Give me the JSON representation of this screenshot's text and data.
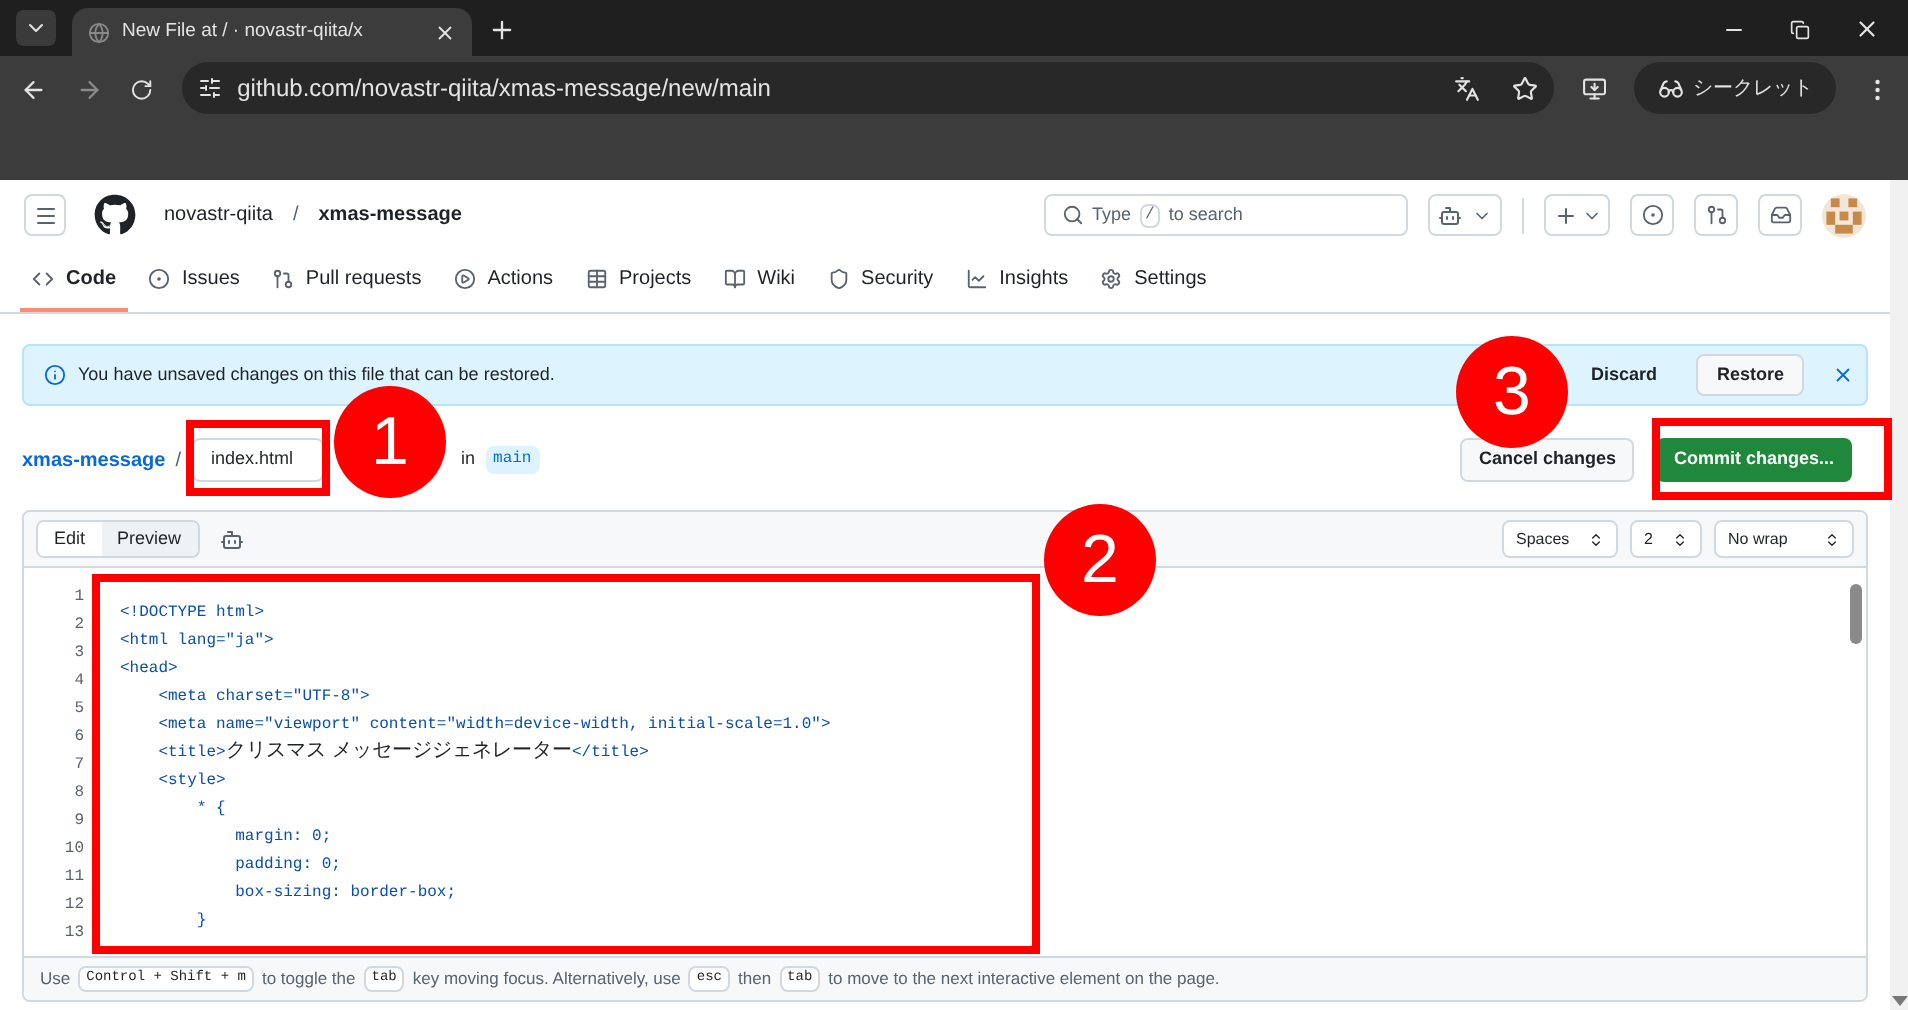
{
  "browser": {
    "tab_title": "New File at / · novastr-qiita/x",
    "url": "github.com/novastr-qiita/xmas-message/new/main",
    "incognito_label": "シークレット"
  },
  "repo": {
    "owner": "novastr-qiita",
    "separator": "/",
    "name": "xmas-message"
  },
  "search": {
    "prefix": "Type",
    "key": "/",
    "suffix": "to search"
  },
  "nav_tabs": [
    {
      "label": "Code",
      "selected": true
    },
    {
      "label": "Issues",
      "selected": false
    },
    {
      "label": "Pull requests",
      "selected": false
    },
    {
      "label": "Actions",
      "selected": false
    },
    {
      "label": "Projects",
      "selected": false
    },
    {
      "label": "Wiki",
      "selected": false
    },
    {
      "label": "Security",
      "selected": false
    },
    {
      "label": "Insights",
      "selected": false
    },
    {
      "label": "Settings",
      "selected": false
    }
  ],
  "banner": {
    "message": "You have unsaved changes on this file that can be restored.",
    "discard": "Discard",
    "restore": "Restore"
  },
  "file": {
    "repo_link": "xmas-message",
    "separator": "/",
    "filename": "index.html",
    "in_label": "in",
    "branch": "main",
    "cancel": "Cancel changes",
    "commit": "Commit changes..."
  },
  "editor": {
    "tabs": [
      {
        "label": "Edit",
        "selected": true
      },
      {
        "label": "Preview",
        "selected": false
      }
    ],
    "indent_mode": "Spaces",
    "indent_size": "2",
    "wrap": "No wrap",
    "lines": [
      {
        "number": "1",
        "segments": [
          {
            "kind": "code",
            "text": "<!DOCTYPE html>"
          }
        ]
      },
      {
        "number": "2",
        "segments": [
          {
            "kind": "code",
            "text": "<html lang=\"ja\">"
          }
        ]
      },
      {
        "number": "3",
        "segments": [
          {
            "kind": "code",
            "text": "<head>"
          }
        ]
      },
      {
        "number": "4",
        "segments": [
          {
            "kind": "code",
            "text": "    <meta charset=\"UTF-8\">"
          }
        ]
      },
      {
        "number": "5",
        "segments": [
          {
            "kind": "code",
            "text": "    <meta name=\"viewport\" content=\"width=device-width, initial-scale=1.0\">"
          }
        ]
      },
      {
        "number": "6",
        "segments": [
          {
            "kind": "code",
            "text": "    <title>"
          },
          {
            "kind": "plain",
            "text": "クリスマス メッセージジェネレーター"
          },
          {
            "kind": "code",
            "text": "</title>"
          }
        ]
      },
      {
        "number": "7",
        "segments": [
          {
            "kind": "code",
            "text": "    <style>"
          }
        ]
      },
      {
        "number": "8",
        "segments": [
          {
            "kind": "code",
            "text": "        * {"
          }
        ]
      },
      {
        "number": "9",
        "segments": [
          {
            "kind": "code",
            "text": "            margin: 0;"
          }
        ]
      },
      {
        "number": "10",
        "segments": [
          {
            "kind": "code",
            "text": "            padding: 0;"
          }
        ]
      },
      {
        "number": "11",
        "segments": [
          {
            "kind": "code",
            "text": "            box-sizing: border-box;"
          }
        ]
      },
      {
        "number": "12",
        "segments": [
          {
            "kind": "code",
            "text": "        }"
          }
        ]
      },
      {
        "number": "13"
      }
    ]
  },
  "footer": [
    {
      "kind": "text",
      "text": "Use"
    },
    {
      "kind": "key",
      "text": "Control + Shift + m"
    },
    {
      "kind": "text",
      "text": "to toggle the"
    },
    {
      "kind": "key",
      "text": "tab"
    },
    {
      "kind": "text",
      "text": "key moving focus. Alternatively, use"
    },
    {
      "kind": "key",
      "text": "esc"
    },
    {
      "kind": "text",
      "text": "then"
    },
    {
      "kind": "key",
      "text": "tab"
    },
    {
      "kind": "text",
      "text": "to move to the next interactive element on the page."
    }
  ],
  "callouts": [
    {
      "label": "1"
    },
    {
      "label": "2"
    },
    {
      "label": "3"
    }
  ]
}
